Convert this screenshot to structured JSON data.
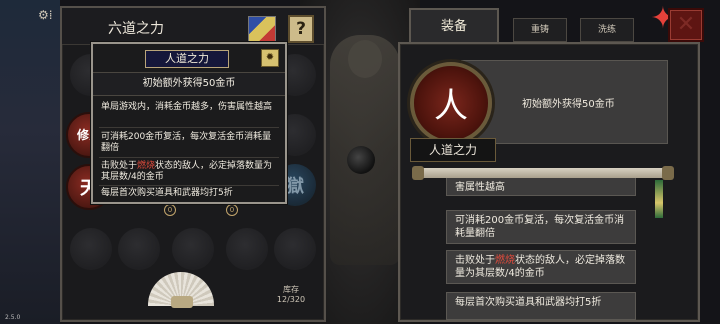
{
  "left_panel": {
    "title": "六道之力",
    "help_label": "?",
    "stock_label": "库存",
    "stock_value": "12/320",
    "slot_chars": [
      "修罗",
      "天"
    ],
    "slot_right_char": "獄",
    "ring_labels": [
      "0",
      "0"
    ]
  },
  "tooltip": {
    "title": "人道之力",
    "headline": "初始额外获得50金币",
    "entries": [
      "单局游戏内，消耗金币越多，伤害属性越高",
      "可消耗200金币复活，每次复活金币消耗量翻倍",
      "击败处于",
      "燃烧",
      "状态的敌人，必定掉落数量为其层数/4的金币",
      "每层首次购买道具和武器均打5折"
    ]
  },
  "right_panel": {
    "tabs": [
      "装备",
      "重铸",
      "洗练"
    ],
    "medallion_char": "人",
    "name": "人道之力",
    "info_text": "初始额外获得50金币",
    "cards": [
      "害属性越高",
      "可消耗200金币复活，每次复活金币消耗量翻倍",
      "击败处于",
      "燃烧",
      "状态的敌人，必定掉落数量为其层数/4的金币",
      "每层首次购买道具和武器均打5折"
    ]
  },
  "version": "2.5.0",
  "colors": {
    "accent_red": "#e14b3c",
    "panel_bg": "#1b1b1d",
    "card_bg": "#3d3c3c",
    "tooltip_title_bg": "#15173a"
  },
  "icons": [
    "gear-icon",
    "triangle-settings-icon",
    "help-icon",
    "close-icon",
    "fan-icon",
    "medallion-icon"
  ]
}
